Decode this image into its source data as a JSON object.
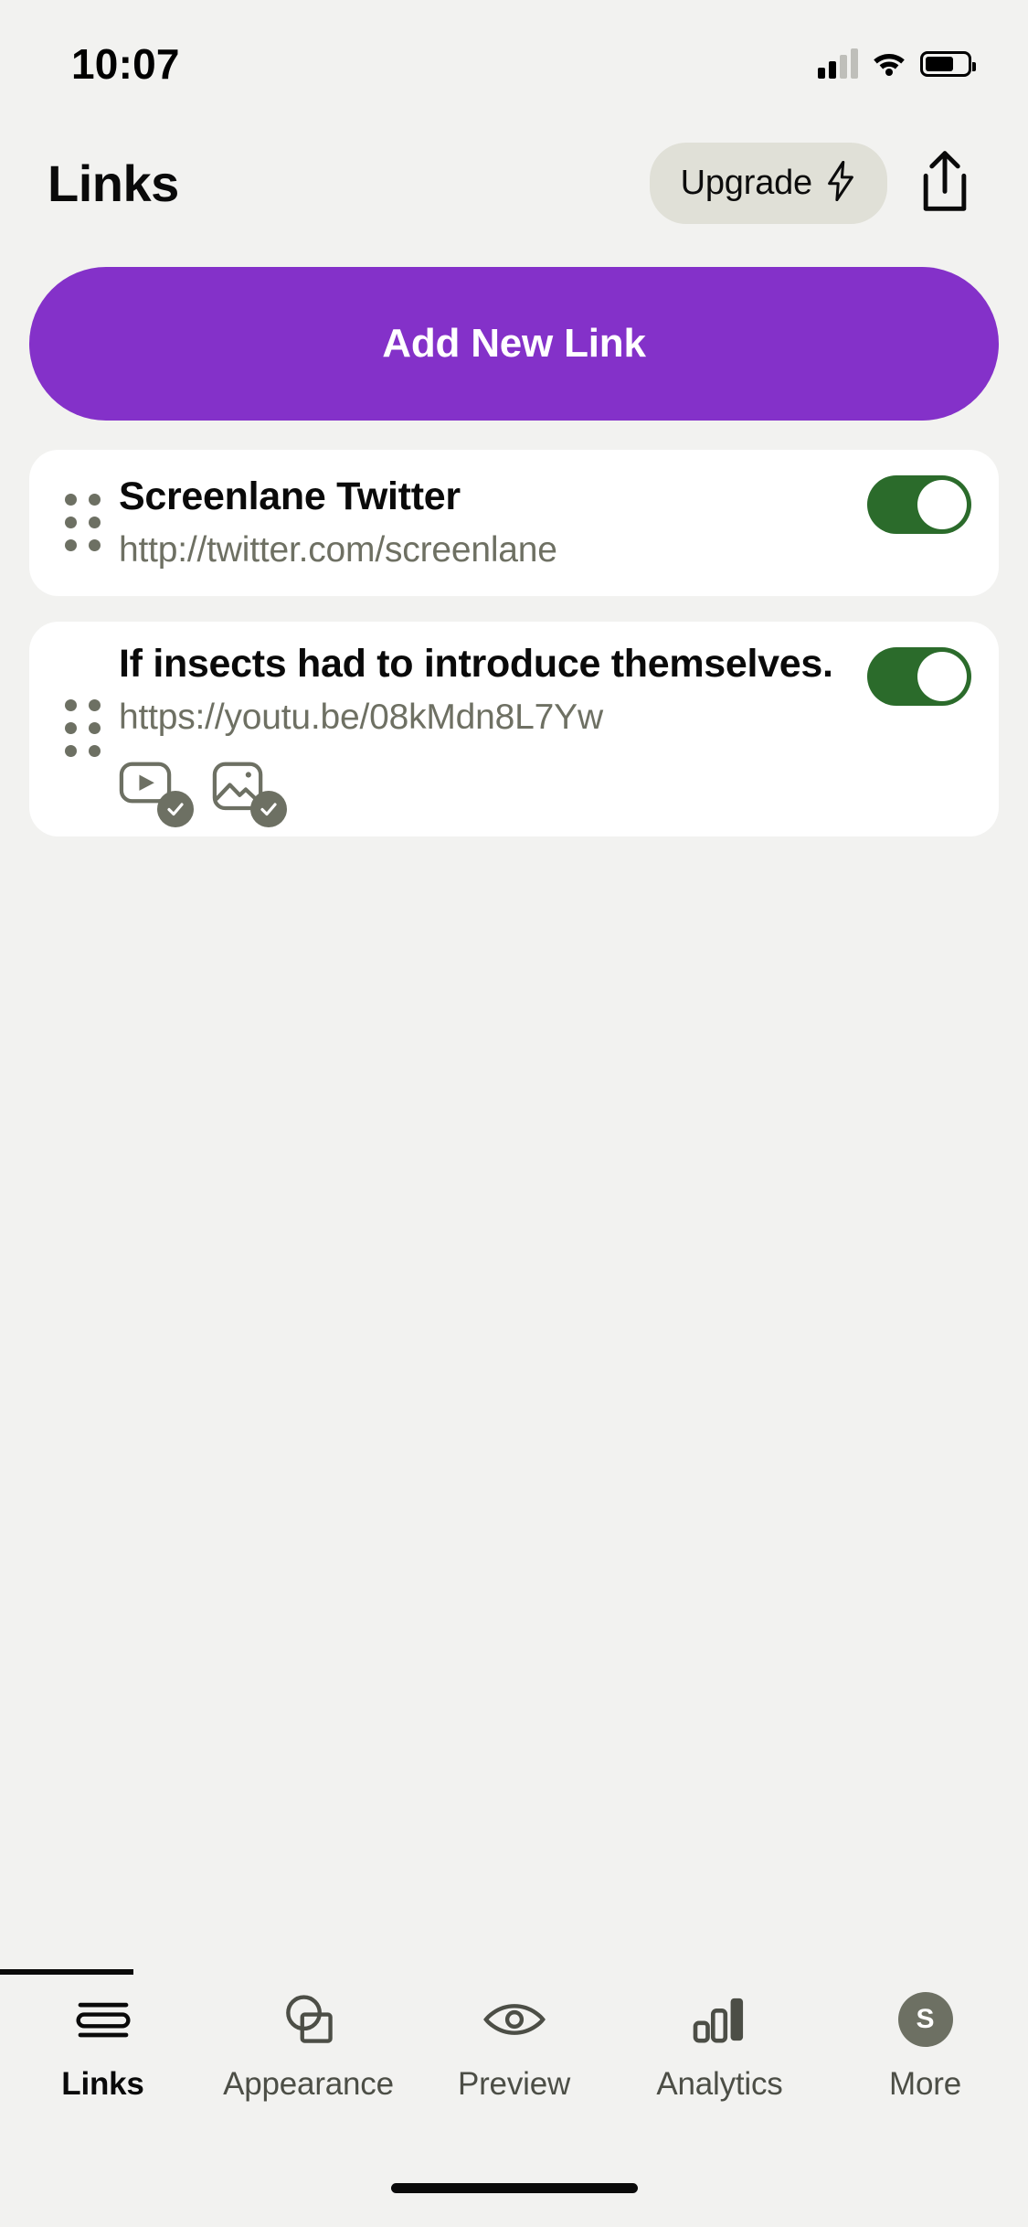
{
  "status_bar": {
    "time": "10:07",
    "cellular_icon": "cellular-signal-icon",
    "wifi_icon": "wifi-icon",
    "battery_icon": "battery-icon"
  },
  "header": {
    "title": "Links",
    "upgrade_label": "Upgrade",
    "upgrade_icon": "lightning-bolt-icon",
    "share_icon": "share-upload-icon"
  },
  "primary_action": {
    "add_link_label": "Add New Link"
  },
  "links": [
    {
      "title": "Screenlane Twitter",
      "url": "http://twitter.com/screenlane",
      "enabled": true,
      "drag_handle_icon": "drag-handle-icon",
      "media": []
    },
    {
      "title": "If insects had to introduce themselves.",
      "url": "https://youtu.be/08kMdn8L7Yw",
      "enabled": true,
      "drag_handle_icon": "drag-handle-icon",
      "media": [
        {
          "icon": "video-thumbnail-icon",
          "state": "checked"
        },
        {
          "icon": "image-thumbnail-icon",
          "state": "checked"
        }
      ]
    }
  ],
  "tabs": [
    {
      "label": "Links",
      "icon": "links-stack-icon",
      "active": true
    },
    {
      "label": "Appearance",
      "icon": "shapes-icon",
      "active": false
    },
    {
      "label": "Preview",
      "icon": "eye-icon",
      "active": false
    },
    {
      "label": "Analytics",
      "icon": "bar-chart-icon",
      "active": false
    },
    {
      "label": "More",
      "icon": "avatar-icon",
      "active": false,
      "avatar_initial": "S"
    }
  ],
  "colors": {
    "background": "#F2F2F0",
    "card": "#FFFFFF",
    "accent_purple": "#8431C9",
    "toggle_on_green": "#2B6B2B",
    "muted_text": "#6E7063",
    "pill_background": "#E0E0D7"
  },
  "home_indicator": "home-indicator"
}
